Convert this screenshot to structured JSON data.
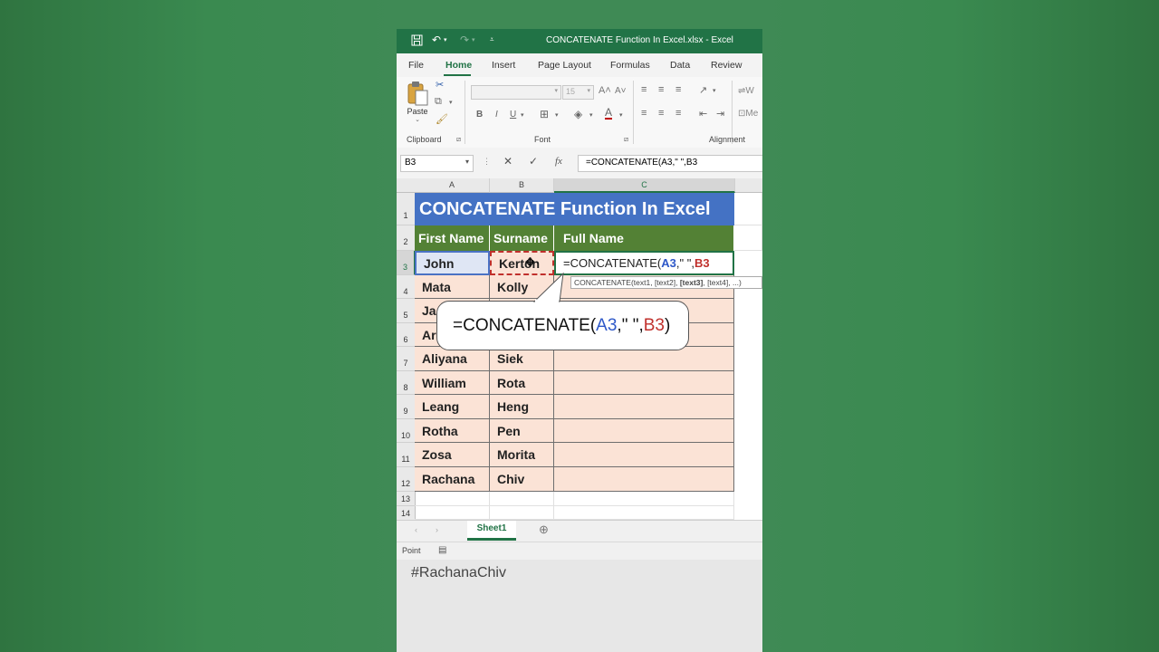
{
  "window": {
    "title": "CONCATENATE Function In Excel.xlsx  -  Excel"
  },
  "tabs": [
    "File",
    "Home",
    "Insert",
    "Page Layout",
    "Formulas",
    "Data",
    "Review"
  ],
  "ribbon": {
    "paste_label": "Paste",
    "clipboard_label": "Clipboard",
    "font_label": "Font",
    "alignment_label": "Alignment",
    "font_size": "15",
    "bold": "B",
    "italic": "I",
    "underline": "U",
    "wrap_label": "W",
    "merge_label": "Me"
  },
  "formula_bar": {
    "name_box": "B3",
    "fx": "fx",
    "formula": "=CONCATENATE(A3,\" \",B3"
  },
  "columns": [
    "A",
    "B",
    "C"
  ],
  "rows": [
    "1",
    "2",
    "3",
    "4",
    "5",
    "6",
    "7",
    "8",
    "9",
    "10",
    "11",
    "12",
    "13",
    "14"
  ],
  "sheet": {
    "title": "CONCATENATE Function In Excel",
    "headers": [
      "First Name",
      "Surname",
      "Full Name"
    ],
    "data": [
      [
        "John",
        "Kerton"
      ],
      [
        "Mata",
        "Kolly"
      ],
      [
        "Ja",
        ""
      ],
      [
        "Ar",
        ""
      ],
      [
        "Aliyana",
        "Siek"
      ],
      [
        "William",
        "Rota"
      ],
      [
        "Leang",
        "Heng"
      ],
      [
        "Rotha",
        "Pen"
      ],
      [
        "Zosa",
        "Morita"
      ],
      [
        "Rachana",
        "Chiv"
      ]
    ],
    "editing_cell": {
      "prefix": "=CONCATENATE(",
      "ref1": "A3",
      "mid": ",\" \",",
      "ref2": "B3"
    },
    "tooltip": {
      "fn": "CONCATENATE(text1, [text2], ",
      "bold_arg": "[text3]",
      "rest": ", [text4], ...)"
    }
  },
  "callout": {
    "prefix": "=CONCATENATE(",
    "ref1": "A3",
    "mid": ",\" \",",
    "ref2": "B3",
    "close": ")"
  },
  "sheet_tabs": [
    "Sheet1"
  ],
  "status": {
    "mode": "Point"
  },
  "watermark": "#RachanaChiv",
  "colors": {
    "excel_green": "#217346",
    "header_green": "#538135",
    "title_blue": "#4472c4",
    "peach": "#fbe3d6",
    "ref_blue": "#2e58c8",
    "ref_red": "#c0302c"
  }
}
